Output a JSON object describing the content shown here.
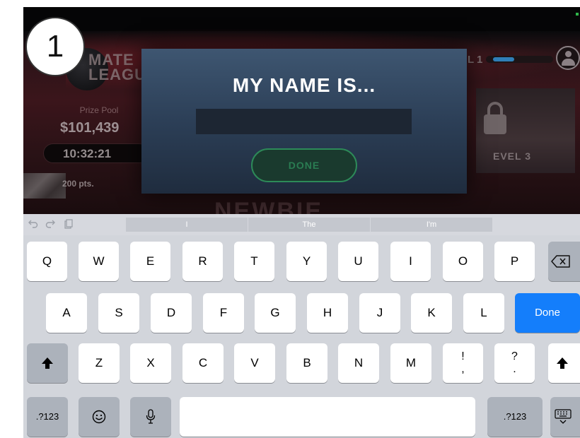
{
  "badge": {
    "number": "1"
  },
  "game": {
    "league_name_line1": "MATE",
    "league_name_line2": "LEAGUE",
    "prize_pool_label": "Prize Pool",
    "prize_pool_value": "$101,439",
    "timer": "10:32:21",
    "points": "200 pts.",
    "level_label": "L 1",
    "locked_level_label": "EVEL 3",
    "banner_text": "NEWBIE"
  },
  "modal": {
    "title": "MY NAME IS...",
    "input_value": "",
    "done_label": "DONE"
  },
  "keyboard": {
    "suggestions": [
      "I",
      "The",
      "I'm"
    ],
    "row1": [
      "Q",
      "W",
      "E",
      "R",
      "T",
      "Y",
      "U",
      "I",
      "O",
      "P"
    ],
    "row2": [
      "A",
      "S",
      "D",
      "F",
      "G",
      "H",
      "J",
      "K",
      "L"
    ],
    "row3": [
      "Z",
      "X",
      "C",
      "V",
      "B",
      "N",
      "M"
    ],
    "row3_punct1_top": "!",
    "row3_punct1_bottom": ",",
    "row3_punct2_top": "?",
    "row3_punct2_bottom": ".",
    "done_label": "Done",
    "numbers_label": ".?123",
    "icons": {
      "undo": "undo-icon",
      "redo": "redo-icon",
      "paste": "paste-icon",
      "backspace": "backspace-icon",
      "shift": "shift-icon",
      "emoji": "emoji-icon",
      "mic": "microphone-icon",
      "hide_keyboard": "hide-keyboard-icon"
    }
  }
}
